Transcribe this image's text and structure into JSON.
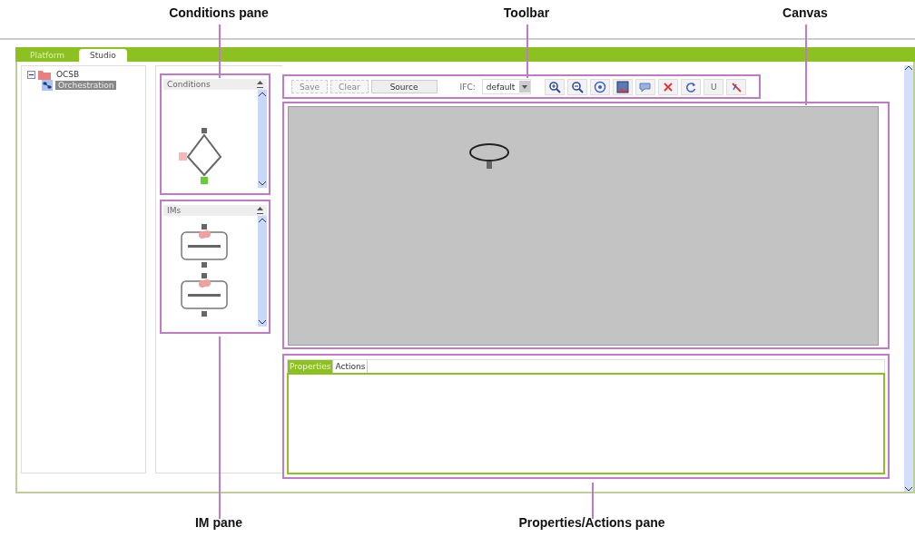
{
  "callouts": [
    {
      "label": "Conditions pane"
    },
    {
      "label": "Toolbar"
    },
    {
      "label": "Canvas"
    },
    {
      "label": "IM pane"
    },
    {
      "label": "Properties/Actions pane"
    }
  ],
  "window": {
    "tabs": [
      {
        "label": "Platform",
        "selected": false
      },
      {
        "label": "Studio",
        "selected": true
      }
    ]
  },
  "tree": [
    {
      "label": "OCSB",
      "expanded": true,
      "selected": false,
      "children": [
        {
          "label": "Orchestration",
          "selected": true
        }
      ]
    }
  ],
  "palettes": [
    {
      "title": "Conditions",
      "kind": "condition"
    },
    {
      "title": "IMs",
      "kind": "im"
    }
  ],
  "toolbar": {
    "buttons": [
      {
        "label": "Save",
        "disabled": true
      },
      {
        "label": "Clear",
        "disabled": true
      },
      {
        "label": "Source",
        "disabled": false
      }
    ],
    "ifc_label": "IFC:",
    "ifc_value": "default",
    "tools": [
      {
        "kind": "zoom-in"
      },
      {
        "kind": "zoom-out"
      },
      {
        "kind": "target"
      },
      {
        "kind": "image"
      },
      {
        "kind": "comment"
      },
      {
        "kind": "delete"
      },
      {
        "kind": "refresh"
      },
      {
        "kind": "text",
        "label": "U"
      },
      {
        "kind": "slash"
      }
    ]
  },
  "properties": {
    "tabs": [
      {
        "label": "Properties",
        "selected": true
      },
      {
        "label": "Actions",
        "selected": false
      }
    ]
  }
}
